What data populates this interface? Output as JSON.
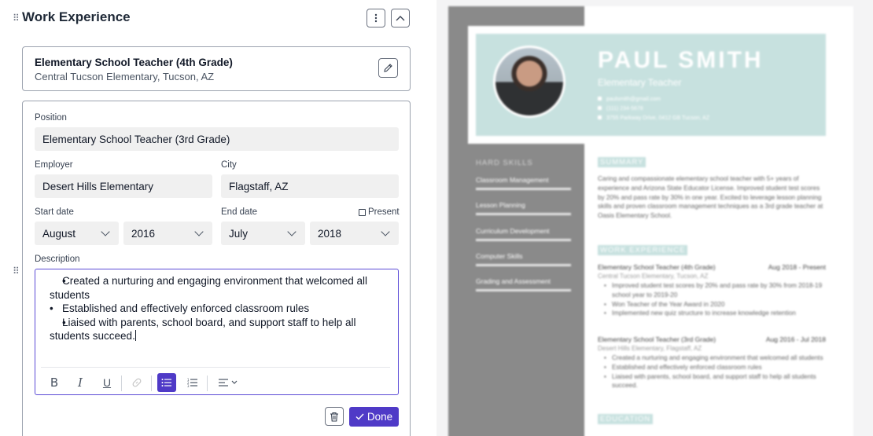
{
  "section": {
    "title": "Work Experience",
    "menu_icon": "vertical-dots-icon",
    "collapse_icon": "chevron-up-icon"
  },
  "collapsed_entry": {
    "title": "Elementary School Teacher (4th Grade)",
    "subtitle": "Central Tucson Elementary, Tucson, AZ",
    "edit_icon": "pencil-icon"
  },
  "form": {
    "position_label": "Position",
    "position_value": "Elementary School Teacher (3rd Grade)",
    "employer_label": "Employer",
    "employer_value": "Desert Hills Elementary",
    "city_label": "City",
    "city_value": "Flagstaff, AZ",
    "start_label": "Start date",
    "start_month": "August",
    "start_year": "2016",
    "end_label": "End date",
    "end_month": "July",
    "end_year": "2018",
    "present_label": "Present",
    "present_checked": false,
    "description_label": "Description",
    "description_bullets": [
      "Created a nurturing and engaging environment that welcomed all students",
      "Established and effectively enforced classroom rules",
      "Liaised with parents, school board, and support staff to help all students succeed."
    ],
    "toolbar": {
      "bold": "B",
      "italic": "I",
      "underline": "U",
      "active_color": "#4f3ac7"
    },
    "done_label": "Done",
    "accent_color": "#4f3ac7"
  },
  "resume": {
    "name": "PAUL SMITH",
    "role": "Elementary Teacher",
    "email": "paulsmith@gmail.com",
    "phone": "(111) 234-5678",
    "address": "3755 Parkway Drive, 0412 GB Tucson, AZ",
    "hard_skills_title": "HARD SKILLS",
    "skills": [
      "Classroom Management",
      "Lesson Planning",
      "Curriculum Development",
      "Computer Skills",
      "Grading and Assessment"
    ],
    "summary_title": "SUMMARY",
    "summary": "Caring and compassionate elementary school teacher with 5+ years of experience and Arizona State Educator License. Improved student test scores by 20% and pass rate by 30% in one year. Excited to leverage lesson planning skills and proven classroom management techniques as a 3rd grade teacher at Oasis Elementary School.",
    "work_title": "WORK EXPERIENCE",
    "job1_title": "Elementary School Teacher (4th Grade)",
    "job1_dates": "Aug 2018 - Present",
    "job1_employer": "Central Tucson Elementary, Tucson, AZ",
    "job1_bullets": [
      "Improved student test scores by 20% and pass rate by 30% from 2018-19 school year to 2019-20",
      "Won Teacher of the Year Award in 2020",
      "Implemented new quiz structure to increase knowledge retention"
    ],
    "job2_title": "Elementary School Teacher (3rd Grade)",
    "job2_dates": "Aug 2016 - Jul 2018",
    "job2_employer": "Desert Hills Elementary, Flagstaff, AZ",
    "job2_bullets": [
      "Created a nurturing and engaging environment that welcomed all students",
      "Established and effectively enforced classroom rules",
      "Liaised with parents, school board, and support staff to help all students succeed."
    ],
    "education_title": "EDUCATION",
    "header_color": "#c7e1df",
    "sidebar_color": "#8a8a8a"
  }
}
